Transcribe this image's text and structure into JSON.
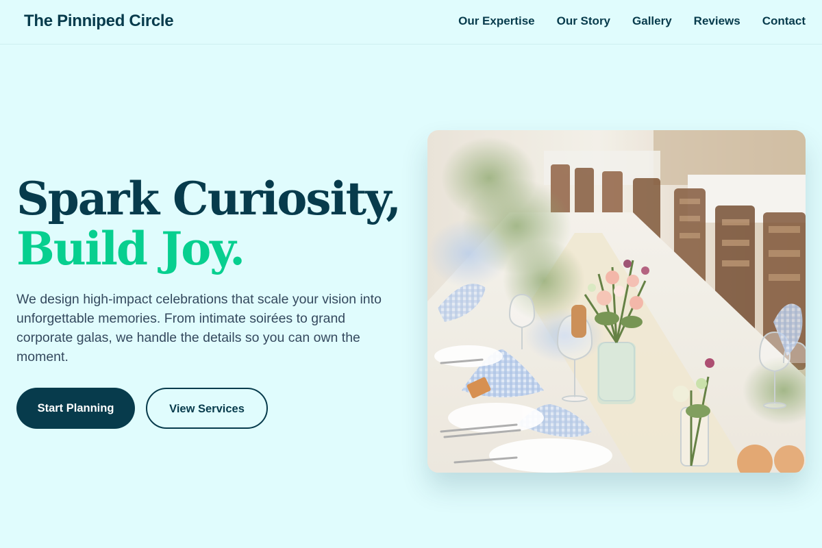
{
  "header": {
    "brand": "The Pinniped Circle",
    "nav": [
      {
        "label": "Our Expertise"
      },
      {
        "label": "Our Story"
      },
      {
        "label": "Gallery"
      },
      {
        "label": "Reviews"
      },
      {
        "label": "Contact"
      }
    ]
  },
  "hero": {
    "title_line1": "Spark Curiosity,",
    "title_line2": "Build Joy.",
    "description": "We design high-impact celebrations that scale your vision into unforgettable memories. From intimate soirées to grand corporate galas, we handle the details so you can own the moment.",
    "primary_button": "Start Planning",
    "secondary_button": "View Services"
  },
  "colors": {
    "background": "#e0fcfd",
    "primary": "#073b4c",
    "accent": "#07cf8f",
    "body_text": "#34495e"
  }
}
